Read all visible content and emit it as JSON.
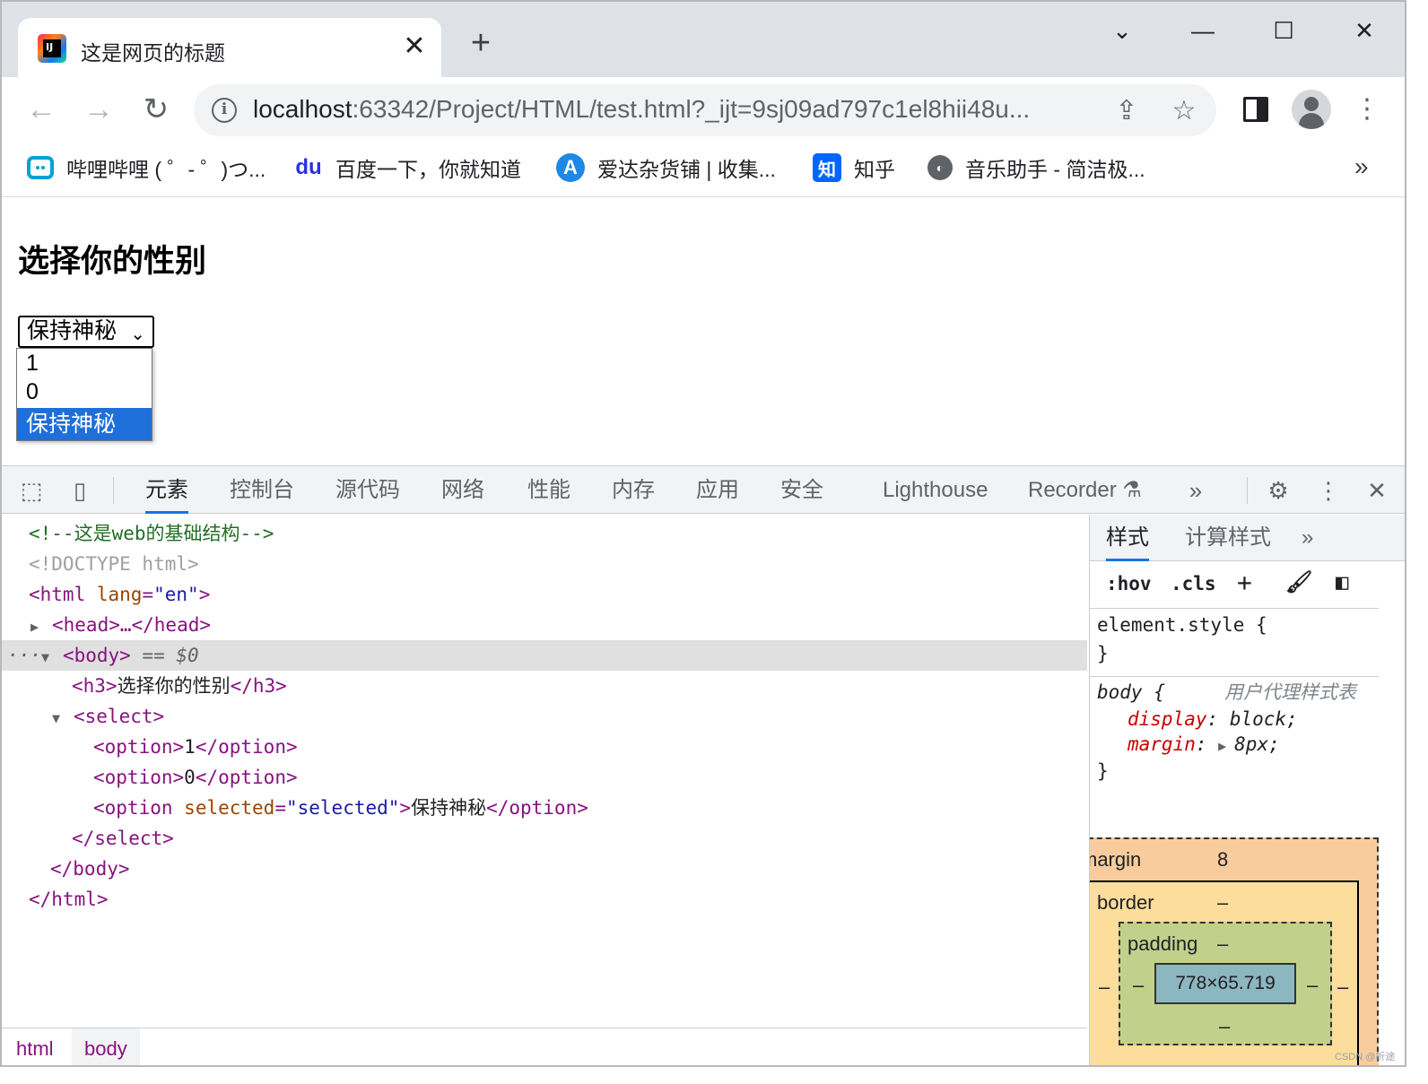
{
  "browser": {
    "tab_title": "这是网页的标题",
    "tab_close": "✕",
    "new_tab": "+",
    "window_controls": [
      "⌄",
      "—",
      "☐",
      "✕"
    ],
    "url_host": "localhost",
    "url_rest": ":63342/Project/HTML/test.html?_ijt=9sj09ad797c1el8hii48u...",
    "bookmarks": [
      {
        "label": "哔哩哔哩 ( ゜- ゜)つ...",
        "icon": "bilibili-icon"
      },
      {
        "label": "百度一下，你就知道",
        "icon": "baidu-icon",
        "glyph": "du"
      },
      {
        "label": "爱达杂货铺 | 收集...",
        "icon": "ada-icon",
        "glyph": "A"
      },
      {
        "label": "知乎",
        "icon": "zhihu-icon",
        "glyph": "知"
      },
      {
        "label": "音乐助手 - 简洁极...",
        "icon": "globe-icon",
        "glyph": "◐"
      }
    ],
    "bookmarks_more": "»"
  },
  "page": {
    "heading": "选择你的性别",
    "select_value": "保持神秘",
    "options": [
      "1",
      "0",
      "保持神秘"
    ],
    "selected_index": 2
  },
  "devtools": {
    "tabs": [
      "元素",
      "控制台",
      "源代码",
      "网络",
      "性能",
      "内存",
      "应用",
      "安全",
      "Lighthouse",
      "Recorder"
    ],
    "active_tab": "元素",
    "more_tabs": "»",
    "dom": {
      "comment": "<!--这是web的基础结构-->",
      "doctype": "<!DOCTYPE html>",
      "html_open_tag": "<html",
      "html_lang_attr": "lang",
      "html_lang_value": "\"en\"",
      "head_collapsed": "<head>…</head>",
      "body_open": "<body>",
      "body_marker": "== $0",
      "h3_open": "<h3>",
      "h3_text": "选择你的性别",
      "h3_close": "</h3>",
      "select_open": "<select>",
      "option1": "1",
      "option2": "0",
      "option3_attr": "selected",
      "option3_value": "\"selected\"",
      "option3_text": "保持神秘",
      "option_open": "<option>",
      "option_open_start": "<option",
      "option_close": "</option>",
      "select_close": "</select>",
      "body_close": "</body>",
      "html_close": "</html>",
      "ellipsis": "···",
      "eq": "=",
      "gt": ">"
    },
    "breadcrumbs": [
      "html",
      "body"
    ],
    "styles_tabs": [
      "样式",
      "计算样式"
    ],
    "styles_more": "»",
    "filter_hov": ":hov",
    "filter_cls": ".cls",
    "element_style_selector": "element.style {",
    "rule_close": "}",
    "body_selector": "body {",
    "user_agent_label": "用户代理样式表",
    "prop1_name": "display",
    "prop1_value": "block;",
    "prop2_name": "margin",
    "prop2_value": "8px;",
    "box_model": {
      "margin_label": "margin",
      "margin_value": "8",
      "border_label": "border",
      "border_value": "–",
      "padding_label": "padding",
      "padding_value": "–",
      "content_size": "778×65.719",
      "dash": "–"
    }
  },
  "watermark": "CSDN @折途"
}
